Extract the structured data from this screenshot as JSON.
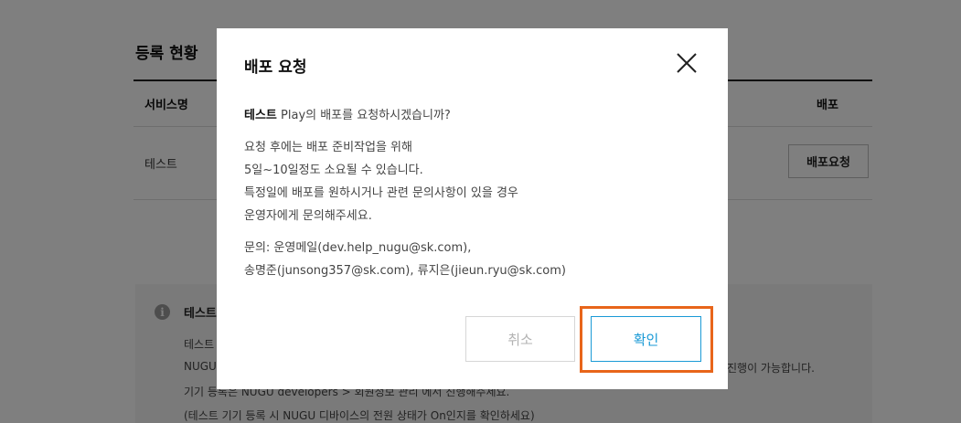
{
  "background": {
    "section_title": "등록 현황",
    "table": {
      "headers": {
        "service_name": "서비스명",
        "deploy": "배포"
      },
      "rows": [
        {
          "service_name": "테스트",
          "action_label": "배포요청"
        }
      ]
    },
    "notice": {
      "title": "테스트",
      "lines": [
        "테스트",
        "NUGU",
        "기기 등록은 NUGU developers > 회원정보 관리 에서 진행해주세요.",
        "(테스트 기기 등록 시 NUGU 디바이스의 전원 상태가 On인지를 확인하세요)"
      ],
      "right_text": "진행이 가능합니다."
    }
  },
  "modal": {
    "title": "배포 요청",
    "question": {
      "service_name": "테스트",
      "text": " Play의 배포를 요청하시겠습니까?"
    },
    "body_lines": [
      "요청 후에는 배포 준비작업을 위해",
      "5일~10일정도 소요될 수 있습니다.",
      "특정일에 배포를 원하시거나 관련 문의사항이 있을 경우",
      "운영자에게 문의해주세요."
    ],
    "contact_lines": [
      "문의: 운영메일(dev.help_nugu@sk.com),",
      "송명준(junsong357@sk.com), 류지은(jieun.ryu@sk.com)"
    ],
    "cancel_label": "취소",
    "confirm_label": "확인"
  },
  "colors": {
    "overlay": "rgba(0,0,0,0.5)",
    "confirm_accent": "#1a9ad6",
    "highlight": "#e8651a"
  },
  "icons": {
    "close": "close-icon",
    "info": "info-icon"
  }
}
